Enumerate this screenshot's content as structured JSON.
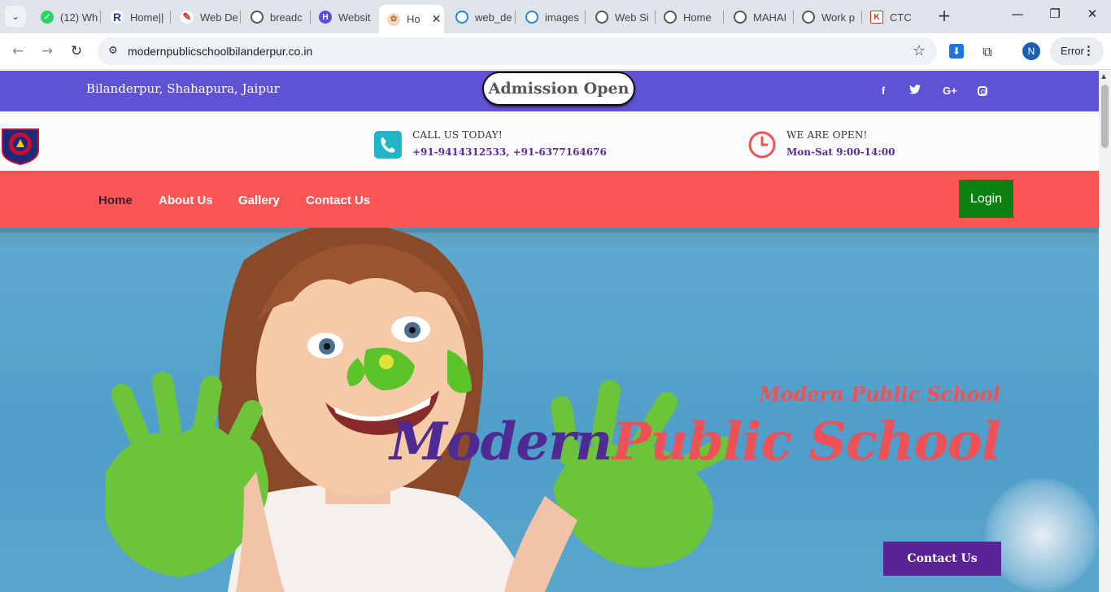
{
  "browser": {
    "tabs": [
      {
        "title": "(12) Wh",
        "icon": "whatsapp-icon",
        "color": "#25d366"
      },
      {
        "title": "Home||",
        "icon": "r-logo-icon",
        "color": "#1a3f8f"
      },
      {
        "title": "Web De",
        "icon": "pencil-icon",
        "color": "#d93025"
      },
      {
        "title": "breadc",
        "icon": "globe-icon",
        "color": "#555555"
      },
      {
        "title": "Websit",
        "icon": "h-logo-icon",
        "color": "#5b4bd6"
      },
      {
        "title": "Ho",
        "icon": "school-favicon",
        "color": "#c0703a",
        "active": true
      },
      {
        "title": "web_de",
        "icon": "cloud-icon",
        "color": "#1e88e5"
      },
      {
        "title": "images",
        "icon": "cloud-icon",
        "color": "#1e88e5"
      },
      {
        "title": "Web Si",
        "icon": "globe-icon",
        "color": "#555555"
      },
      {
        "title": "Home",
        "icon": "globe-icon",
        "color": "#555555"
      },
      {
        "title": "MAHAI",
        "icon": "globe-icon",
        "color": "#555555"
      },
      {
        "title": "Work p",
        "icon": "globe-icon",
        "color": "#555555"
      },
      {
        "title": "CTC",
        "icon": "ctc-logo-icon",
        "color": "#d93025"
      }
    ],
    "url": "modernpublicschoolbilanderpur.co.in",
    "profile_initial": "N",
    "error_label": "Error"
  },
  "site": {
    "topbar": {
      "address": "Bilanderpur, Shahapura, Jaipur",
      "admission": "Admission Open",
      "social": [
        {
          "icon": "facebook-icon",
          "glyph": "f"
        },
        {
          "icon": "twitter-icon",
          "glyph": "🐦"
        },
        {
          "icon": "google-plus-icon",
          "glyph": "G+"
        },
        {
          "icon": "instagram-icon",
          "glyph": ""
        }
      ]
    },
    "info": {
      "call_label": "CALL US TODAY!",
      "call_value": "+91-9414312533, +91-6377164676",
      "open_label": "WE ARE OPEN!",
      "open_value": "Mon-Sat 9:00-14:00"
    },
    "nav": {
      "items": [
        "Home",
        "About Us",
        "Gallery",
        "Contact Us"
      ],
      "login": "Login"
    },
    "hero": {
      "subtitle": "Modern Public School",
      "title_part1": "Modern",
      "title_part2": "Public School",
      "cta": "Contact Us"
    },
    "colors": {
      "topbar": "#6052d5",
      "navbar": "#fc5556",
      "login": "#0a8110",
      "purple": "#5a2496",
      "coral": "#ef5158"
    }
  }
}
